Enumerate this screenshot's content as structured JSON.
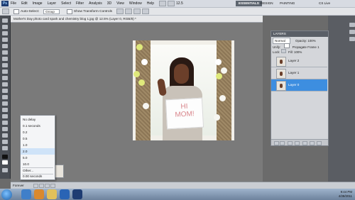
{
  "menubar": {
    "app_logo": "Ps",
    "menus": [
      "File",
      "Edit",
      "Image",
      "Layer",
      "Select",
      "Filter",
      "Analysis",
      "3D",
      "View",
      "Window",
      "Help"
    ],
    "zoom_value": "12.5",
    "workspaces": {
      "active": "ESSENTIALS",
      "design": "DESIGN",
      "painting": "PAINTING"
    },
    "cs_live": "CS Live"
  },
  "options_bar": {
    "auto_select_label": "Auto-Select:",
    "auto_select_value": "Group",
    "show_transform_label": "Show Transform Controls"
  },
  "document": {
    "tab_title": "Mother's Day photo card spark and chemistry blog 1.jpg @ 12.5% (Layer 0, RGB/8) *",
    "sign_line1": "HI",
    "sign_line2": "MOM!"
  },
  "layers_panel": {
    "title": "LAYERS",
    "blend_mode": "Normal",
    "opacity_label": "Opacity:",
    "opacity_value": "100%",
    "unify_label": "Unify:",
    "propagate_label": "Propagate Frame 1",
    "lock_label": "Lock:",
    "fill_label": "Fill:",
    "fill_value": "100%",
    "layers": [
      {
        "name": "Layer 2",
        "visible": false,
        "selected": false
      },
      {
        "name": "Layer 1",
        "visible": false,
        "selected": false
      },
      {
        "name": "Layer 0",
        "visible": true,
        "selected": true
      }
    ]
  },
  "delay_menu": {
    "items": [
      "No delay",
      "0.1 seconds",
      "0.2",
      "0.5",
      "1.0",
      "2.0",
      "5.0",
      "10.0",
      "Other...",
      "0.00 seconds"
    ],
    "highlighted": "2.0"
  },
  "timeline": {
    "frames_label": "Forever",
    "frame_delays": [
      "0 sec.",
      "0 sec."
    ]
  },
  "taskbar": {
    "time": "9:44 PM",
    "date": "4/28/2011"
  },
  "colors": {
    "accent_selected_layer": "#3d8ee0",
    "workspace_active": "#5e6670",
    "sign_text": "#d9868c"
  }
}
